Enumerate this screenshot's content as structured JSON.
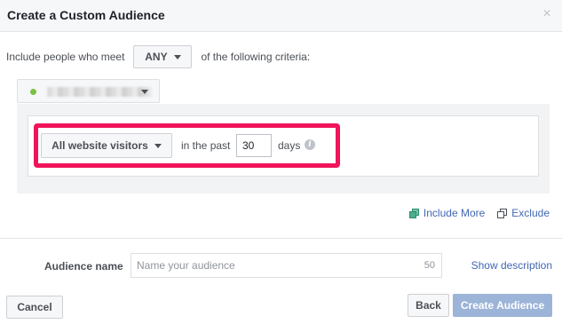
{
  "dialog": {
    "title": "Create a Custom Audience",
    "close_symbol": "×"
  },
  "criteria": {
    "prefix": "Include people who meet",
    "match_value": "ANY",
    "suffix": "of the following criteria:"
  },
  "source": {
    "status_color": "#7bc043",
    "name_blurred": true
  },
  "rule": {
    "visitors_option": "All website visitors",
    "past_label": "in the past",
    "days_value": "30",
    "days_label": "days",
    "info_symbol": "i",
    "highlight_color": "#f0145a"
  },
  "links": {
    "include_more": "Include More",
    "exclude": "Exclude"
  },
  "audience_name": {
    "label": "Audience name",
    "placeholder": "Name your audience",
    "char_limit": "50",
    "show_description": "Show description"
  },
  "footer": {
    "cancel": "Cancel",
    "back": "Back",
    "create": "Create Audience"
  },
  "colors": {
    "link": "#4267b2",
    "primary_disabled": "#9cb4d8"
  }
}
